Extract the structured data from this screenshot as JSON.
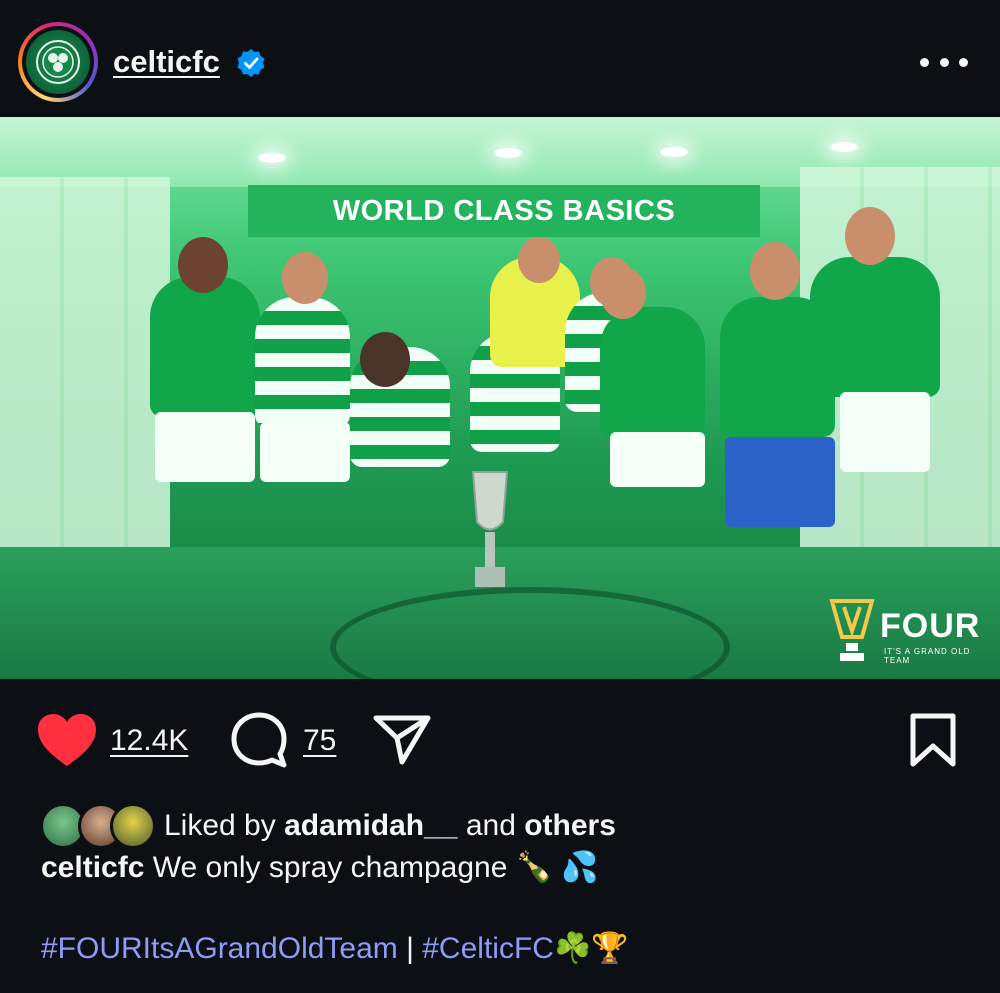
{
  "header": {
    "username": "celticfc",
    "verified": true,
    "avatar_icon": "celtic-crest-icon",
    "more_icon": "more-horizontal-icon"
  },
  "post_image": {
    "banner_text": "WORLD CLASS BASICS",
    "watermark_title": "FOUR",
    "watermark_subtitle": "IT'S A GRAND OLD TEAM",
    "description_icon": "trophy-celebration-photo"
  },
  "actions": {
    "like_icon": "heart-filled-icon",
    "like_count": "12.4K",
    "comment_icon": "comment-icon",
    "comment_count": "75",
    "share_icon": "send-icon",
    "save_icon": "bookmark-icon"
  },
  "likes": {
    "prefix": "Liked by ",
    "user": "adamidah__",
    "middle": " and ",
    "others": "others"
  },
  "caption": {
    "username": "celticfc",
    "text": "We only spray champagne",
    "emoji": "🍾 💦"
  },
  "hashtags": {
    "tag1": "#FOURItsAGrandOldTeam",
    "separator": " | ",
    "tag2": "#CelticFC",
    "emoji": "☘️🏆"
  },
  "colors": {
    "background": "#0c1014",
    "like_red": "#ff3040",
    "verified_blue": "#0095f6",
    "hashtag": "#8f9bf7",
    "celtic_green": "#11a64a"
  }
}
